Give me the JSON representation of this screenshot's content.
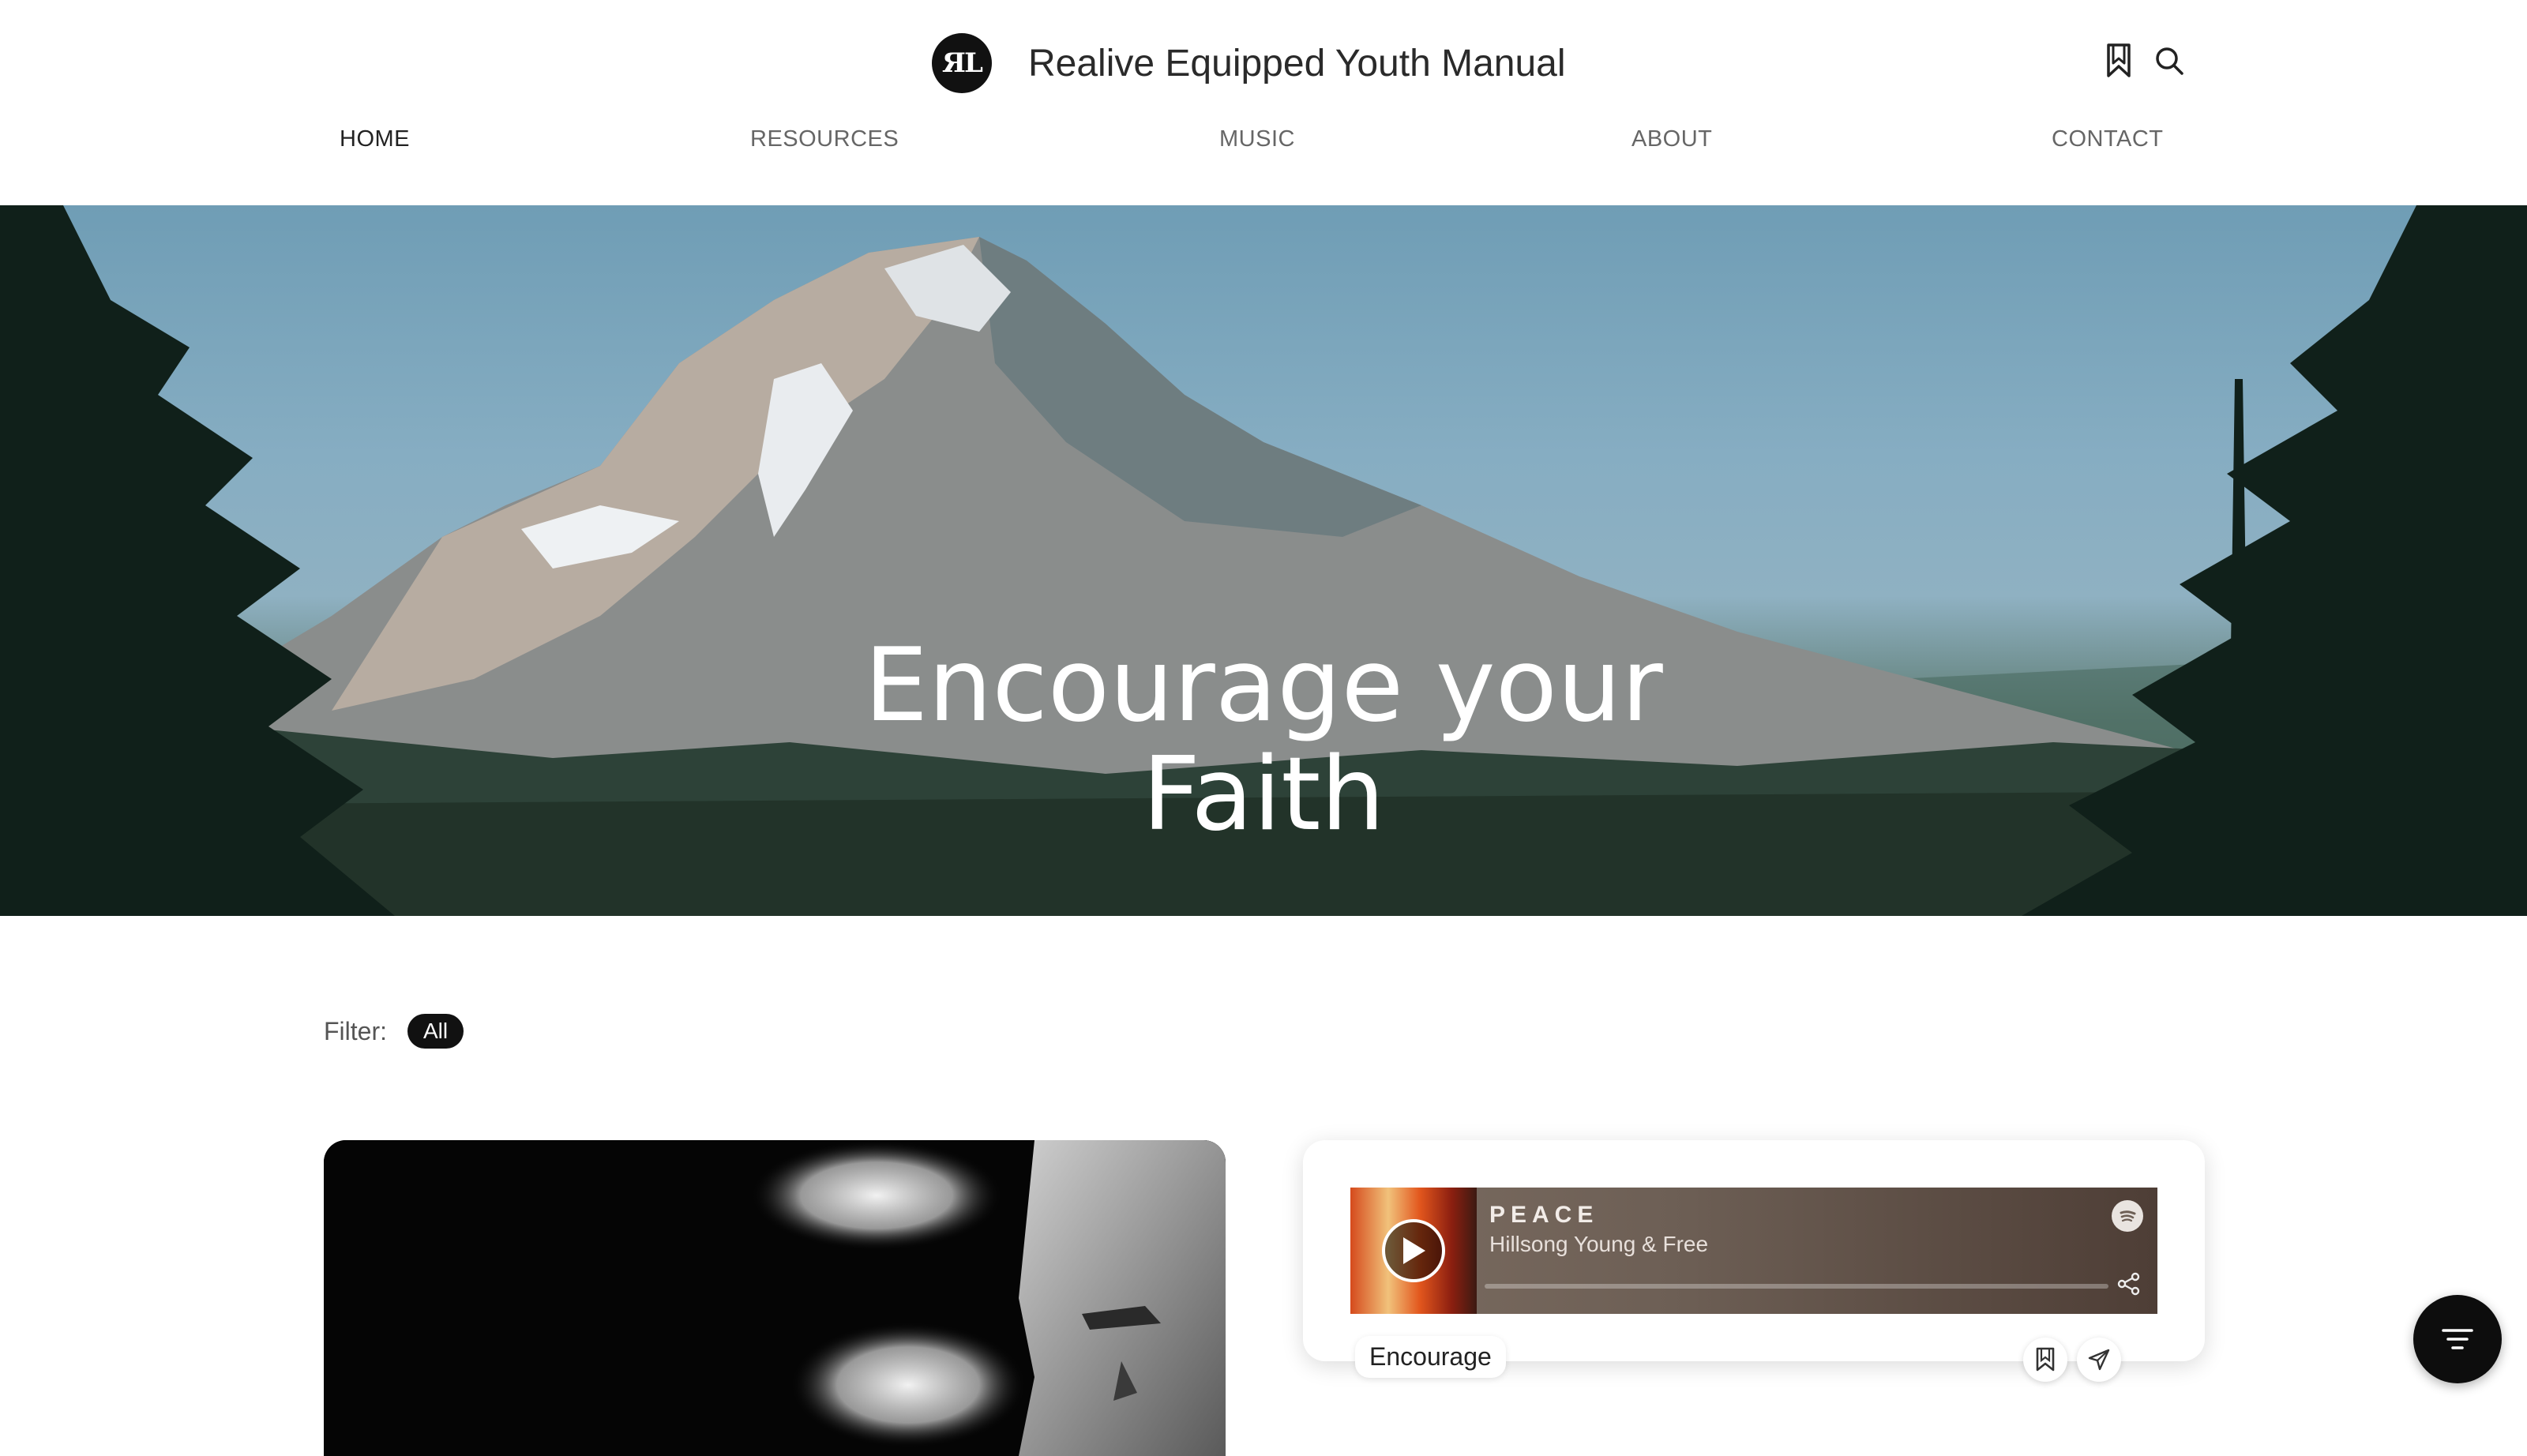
{
  "site": {
    "title": "Realive Equipped Youth Manual",
    "logo_icon": "realive-logo-icon"
  },
  "header": {
    "icons": [
      "bookmark-icon",
      "search-icon"
    ]
  },
  "nav": {
    "items": [
      {
        "label": "HOME",
        "active": true
      },
      {
        "label": "RESOURCES",
        "active": false
      },
      {
        "label": "MUSIC",
        "active": false
      },
      {
        "label": "ABOUT",
        "active": false
      },
      {
        "label": "CONTACT",
        "active": false
      }
    ]
  },
  "hero": {
    "title_line1": "Encourage your",
    "title_line2": "Faith"
  },
  "filter": {
    "label": "Filter:",
    "selected": "All"
  },
  "cards": {
    "music": {
      "song_title": "PEACE",
      "artist": "Hillsong Young & Free",
      "tag": "Encourage",
      "icons": [
        "play-icon",
        "spotify-icon",
        "share-icon",
        "bookmark-icon",
        "send-icon"
      ]
    }
  },
  "fab": {
    "icon": "filter-icon"
  },
  "colors": {
    "accent": "#111111",
    "background": "#ffffff",
    "nav_text": "#666666"
  }
}
